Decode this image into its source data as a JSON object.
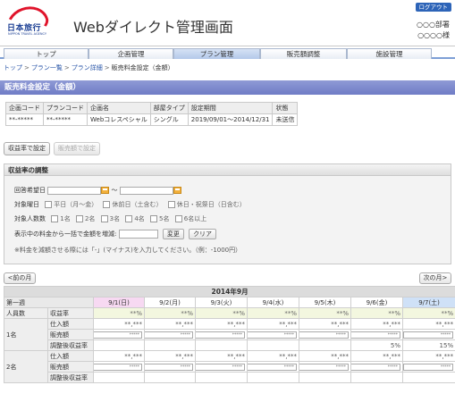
{
  "header": {
    "logo_text": "日本旅行",
    "logo_sub": "NIPPON TRAVEL AGENCY",
    "title": "Webダイレクト管理画面",
    "logout": "ログアウト",
    "department": "○○○部署",
    "user": "○○○○様"
  },
  "nav": {
    "tabs": [
      {
        "label": "トップ"
      },
      {
        "label": "企画管理"
      },
      {
        "label": "プラン管理"
      },
      {
        "label": "販売額調整"
      },
      {
        "label": "施設管理"
      }
    ]
  },
  "breadcrumb": {
    "items": [
      "トップ",
      "プラン一覧",
      "プラン詳細",
      "販売料金設定（金額）"
    ],
    "sep": ">"
  },
  "page_title": "販売料金設定（金額）",
  "plan_table": {
    "headers": [
      "企画コード",
      "プランコード",
      "企画名",
      "部屋タイプ",
      "設定期間",
      "状態"
    ],
    "row": [
      "**-*****",
      "**-*****",
      "Webコレスペシャル",
      "シングル",
      "2019/09/01〜2014/12/31",
      "未送信"
    ]
  },
  "buttons": {
    "profit_setting": "収益率で設定",
    "amount_setting": "販売額で設定"
  },
  "profit": {
    "title": "収益率の調整",
    "period_label": "回答希望日",
    "period_sep": "〜",
    "weekday_label": "対象曜日",
    "weekdays": [
      "平日（月〜金）",
      "休前日（土含む）",
      "休日・祝祭日（日含む）"
    ],
    "persons_label": "対象人数数",
    "persons": [
      "1名",
      "2名",
      "3名",
      "4名",
      "5名",
      "6名以上"
    ],
    "bulk_label": "表示中の料金から一括で金額を増減:",
    "change_btn": "変更",
    "clear_btn": "クリア",
    "note": "※料金を減額させる際には「-」(マイナス)を入力してください。（例：-1000円）"
  },
  "calendar_nav": {
    "prev": "<前の月",
    "next": "次の月>"
  },
  "calendar": {
    "month": "2014年9月",
    "week_label": "第一週",
    "days": [
      "9/1(日)",
      "9/2(月)",
      "9/3(火)",
      "9/4(水)",
      "9/5(木)",
      "9/6(金)",
      "9/7(土)"
    ],
    "persons_header": "人員数",
    "profit_header": "収益率",
    "profit_values": [
      "**%",
      "**%",
      "**%",
      "**%",
      "**%",
      "**%",
      "**%"
    ],
    "groups": [
      {
        "person": "1名",
        "rows": [
          {
            "label": "仕入額",
            "values": [
              "**,***",
              "**,***",
              "**,***",
              "**,***",
              "**,***",
              "**,***",
              "**,***"
            ]
          },
          {
            "label": "販売額",
            "values": [
              "*****",
              "*****",
              "*****",
              "*****",
              "*****",
              "*****",
              "*****"
            ]
          },
          {
            "label": "調整後収益率",
            "values": [
              "",
              "",
              "",
              "",
              "",
              "5%",
              "15%"
            ]
          }
        ]
      },
      {
        "person": "2名",
        "rows": [
          {
            "label": "仕入額",
            "values": [
              "**,***",
              "**,***",
              "**,***",
              "**,***",
              "**,***",
              "**,***",
              "**,***"
            ]
          },
          {
            "label": "販売額",
            "values": [
              "*****",
              "*****",
              "*****",
              "*****",
              "*****",
              "*****",
              "*****"
            ]
          },
          {
            "label": "調整後収益率",
            "values": [
              "",
              "",
              "",
              "",
              "",
              "",
              ""
            ]
          }
        ]
      }
    ]
  },
  "colors": {
    "section_header": "#7b86cc",
    "nav_active": "#b3c8ea",
    "sunday": "#f7d9f2",
    "saturday": "#cfe1f7",
    "logo_red": "#e0142b",
    "logo_blue": "#1c3f94",
    "logout_bg": "#2d64b8"
  }
}
